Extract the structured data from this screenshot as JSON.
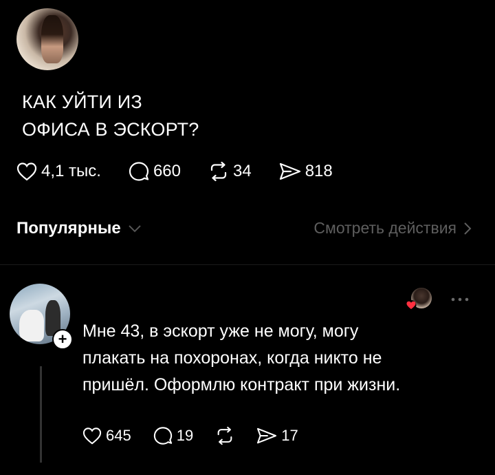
{
  "post": {
    "title": "КАК УЙТИ ИЗ\nОФИСА В ЭСКОРТ?",
    "stats": {
      "likes": "4,1 тыс.",
      "comments": "660",
      "reposts": "34",
      "shares": "818"
    }
  },
  "replies_header": {
    "sort_label": "Популярные",
    "view_actions_label": "Смотреть действия"
  },
  "reply": {
    "text": "Мне 43, в эскорт уже не могу, могу\nплакать на похоронах, когда никто не\nпришёл. Оформлю контракт при жизни.",
    "stats": {
      "likes": "645",
      "comments": "19",
      "shares": "17"
    }
  },
  "icons": {
    "like": "heart-icon",
    "comment": "comment-bubble-icon",
    "repost": "repost-icon",
    "share": "send-icon",
    "sort": "chevron-down-icon",
    "view": "chevron-right-icon",
    "more": "more-dots-icon",
    "follow": "plus-icon"
  },
  "colors": {
    "background": "#000000",
    "text": "#ffffff",
    "muted": "#5e5e5e",
    "heart_badge": "#ff3040"
  }
}
